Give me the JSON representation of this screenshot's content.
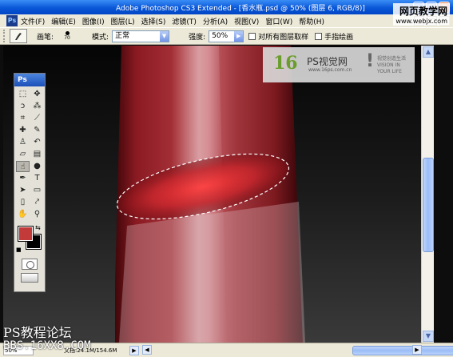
{
  "window": {
    "title": "Adobe Photoshop CS3 Extended - [香水瓶.psd @ 50% (图层 6, RGB/8)]",
    "minimize_label": "_",
    "maximize_label": "□",
    "close_label": "×"
  },
  "watermark": {
    "title": "网页教学网",
    "url": "www.webjx.com"
  },
  "menu": {
    "app_icon": "Ps",
    "items": [
      "文件(F)",
      "编辑(E)",
      "图像(I)",
      "图层(L)",
      "选择(S)",
      "滤镜(T)",
      "分析(A)",
      "视图(V)",
      "窗口(W)",
      "帮助(H)"
    ],
    "doc_min": "_",
    "doc_restore": "□",
    "doc_close": "×"
  },
  "options": {
    "brush_label": "画笔:",
    "brush_size": "70",
    "mode_label": "模式:",
    "mode_value": "正常",
    "strength_label": "强度:",
    "strength_value": "50%",
    "sample_all_label": "对所有图层取样",
    "finger_paint_label": "手指绘画"
  },
  "toolbox": {
    "title": "Ps",
    "tools": [
      {
        "name": "marquee-tool",
        "glyph": "⬚"
      },
      {
        "name": "move-tool",
        "glyph": "✥"
      },
      {
        "name": "lasso-tool",
        "glyph": "ↄ"
      },
      {
        "name": "magic-wand-tool",
        "glyph": "⁂"
      },
      {
        "name": "crop-tool",
        "glyph": "⌗"
      },
      {
        "name": "slice-tool",
        "glyph": "⟋"
      },
      {
        "name": "healing-brush-tool",
        "glyph": "✚"
      },
      {
        "name": "brush-tool",
        "glyph": "✎"
      },
      {
        "name": "clone-stamp-tool",
        "glyph": "♙"
      },
      {
        "name": "history-brush-tool",
        "glyph": "↶"
      },
      {
        "name": "eraser-tool",
        "glyph": "▱"
      },
      {
        "name": "gradient-tool",
        "glyph": "▤"
      },
      {
        "name": "smudge-tool",
        "glyph": "☝"
      },
      {
        "name": "dodge-tool",
        "glyph": "●"
      },
      {
        "name": "pen-tool",
        "glyph": "✒"
      },
      {
        "name": "type-tool",
        "glyph": "T"
      },
      {
        "name": "path-selection-tool",
        "glyph": "➤"
      },
      {
        "name": "shape-tool",
        "glyph": "▭"
      },
      {
        "name": "notes-tool",
        "glyph": "▯"
      },
      {
        "name": "eyedropper-tool",
        "glyph": "⤤"
      },
      {
        "name": "hand-tool",
        "glyph": "✋"
      },
      {
        "name": "zoom-tool",
        "glyph": "⚲"
      }
    ],
    "foreground_color": "#c23a3a",
    "background_color": "#000000"
  },
  "logo": {
    "mark": "16",
    "name": "PS视觉网",
    "url": "www.16ps.com.cn",
    "tagline_1": "视觉创造生活",
    "tagline_2": "VISION IN YOUR LIFE"
  },
  "overlay": {
    "forum": "PS教程论坛",
    "bbs": "BBS.16XX8.COM"
  },
  "status": {
    "zoom": "50%",
    "doc_info": "文档:24.1M/154.6M",
    "arrow": "▶"
  },
  "scroll": {
    "up": "▲",
    "down": "▼",
    "left": "◀",
    "right": "▶"
  }
}
